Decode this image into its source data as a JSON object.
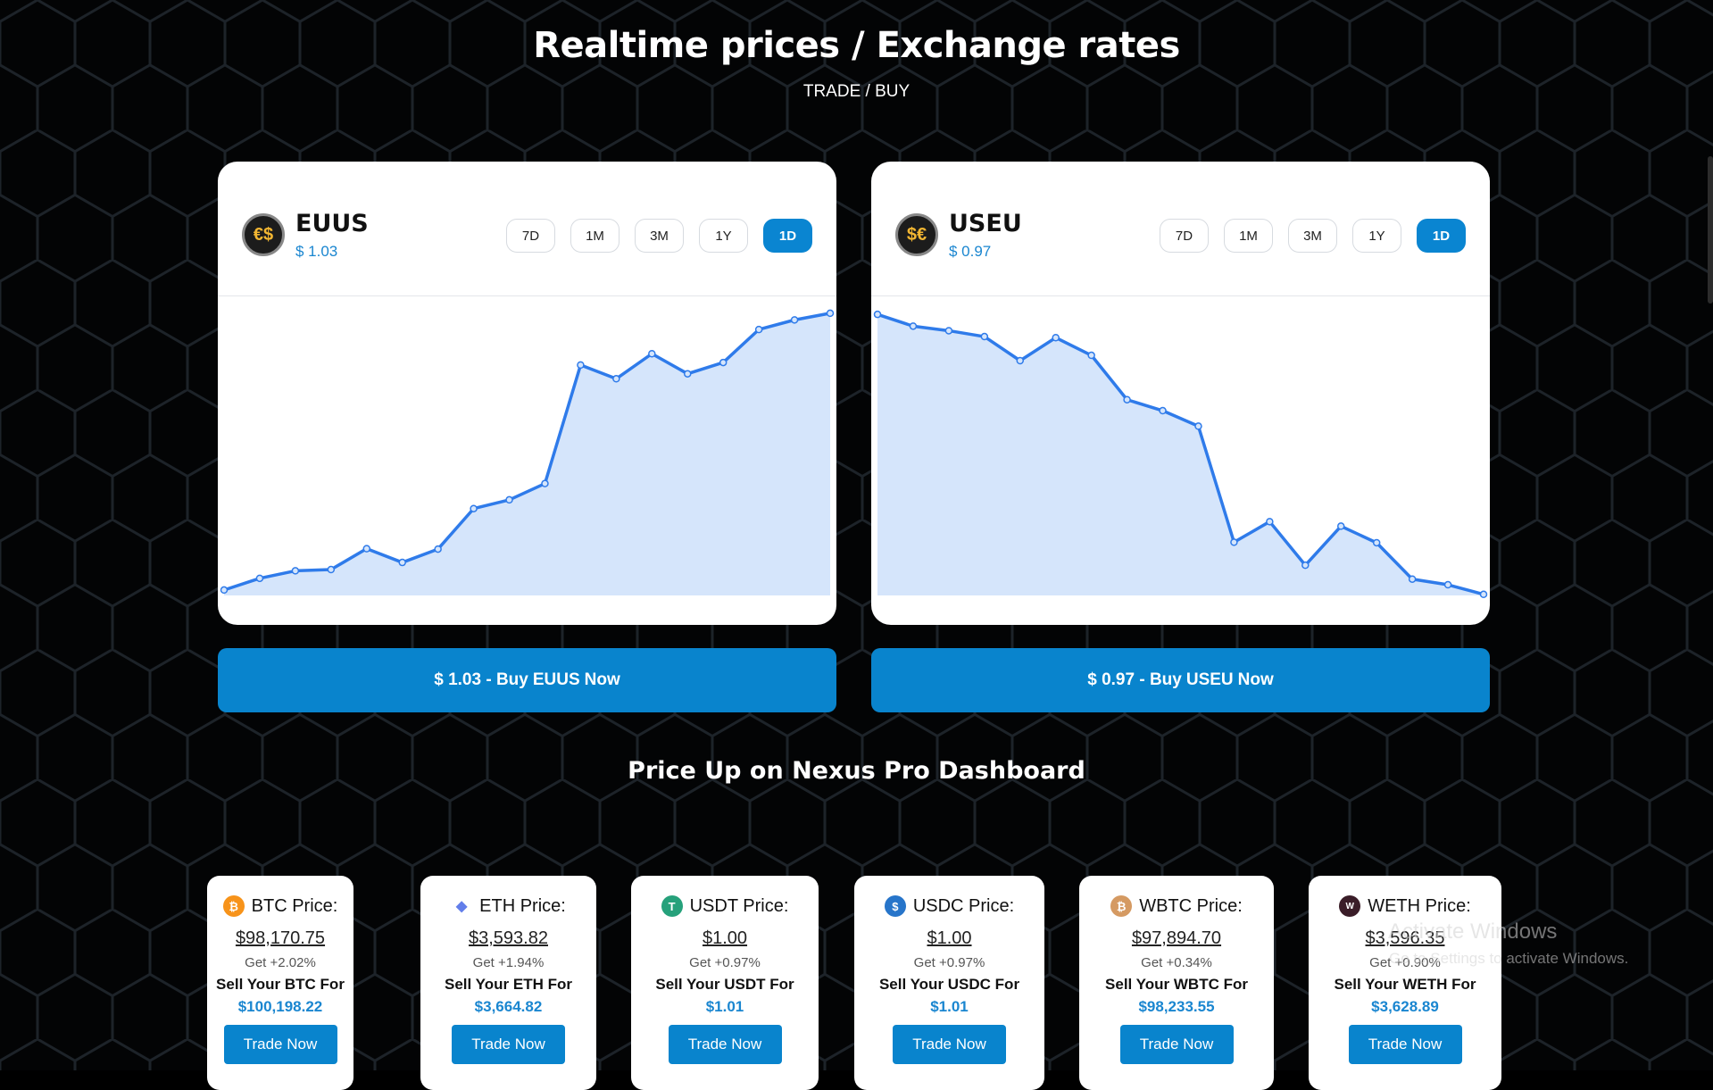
{
  "header": {
    "title": "Realtime prices / Exchange rates",
    "subtitle": "TRADE / BUY"
  },
  "chart_cards": [
    {
      "symbol": "EUUS",
      "price": "$ 1.03",
      "logo_glyphs": "€$",
      "ranges": [
        "7D",
        "1M",
        "3M",
        "1Y",
        "1D"
      ],
      "active_range": "1D",
      "buy_button": {
        "prefix": "$ 1.03 - Buy",
        "symbol": "EUUS",
        "suffix": "Now"
      }
    },
    {
      "symbol": "USEU",
      "price": "$ 0.97",
      "logo_glyphs": "$€",
      "ranges": [
        "7D",
        "1M",
        "3M",
        "1Y",
        "1D"
      ],
      "active_range": "1D",
      "buy_button": {
        "prefix": "$ 0.97 - Buy",
        "symbol": "USEU",
        "suffix": "Now"
      }
    }
  ],
  "chart_data": [
    {
      "type": "area",
      "x": [
        1,
        2,
        3,
        4,
        5,
        6,
        7,
        8,
        9,
        10,
        11,
        12,
        13,
        14,
        15,
        16,
        17,
        18
      ],
      "values": [
        0.98,
        1.26,
        1.44,
        1.47,
        1.97,
        1.64,
        1.96,
        2.93,
        3.14,
        3.53,
        6.37,
        6.04,
        6.64,
        6.16,
        6.43,
        7.22,
        7.45,
        7.61
      ],
      "ylim": [
        0.85,
        7.8
      ],
      "grid": false,
      "line_color": "#2f7bea",
      "fill_color": "#d5e5fb"
    },
    {
      "type": "area",
      "x": [
        1,
        2,
        3,
        4,
        5,
        6,
        7,
        8,
        9,
        10,
        11,
        12,
        13,
        14,
        15,
        16,
        17,
        18
      ],
      "values": [
        9.66,
        9.22,
        9.05,
        8.83,
        7.93,
        8.79,
        8.13,
        6.47,
        6.06,
        5.48,
        1.14,
        1.91,
        0.28,
        1.74,
        1.12,
        -0.24,
        -0.45,
        -0.81
      ],
      "ylim": [
        -0.85,
        10.0
      ],
      "grid": false,
      "line_color": "#2f7bea",
      "fill_color": "#d5e5fb"
    }
  ],
  "section_title": "Price Up on Nexus Pro Dashboard",
  "price_cards": [
    {
      "coin": "BTC",
      "label": "BTC Price:",
      "price": "$98,170.75",
      "get": "Get +2.02%",
      "sell": "Sell Your BTC For",
      "sell_price": "$100,198.22",
      "trade": "Trade Now",
      "icon": "bitcoin-icon",
      "icon_glyph": "₿",
      "icon_color": "#f7931a"
    },
    {
      "coin": "ETH",
      "label": "ETH Price:",
      "price": "$3,593.82",
      "get": "Get +1.94%",
      "sell": "Sell Your ETH For",
      "sell_price": "$3,664.82",
      "trade": "Trade Now",
      "icon": "ethereum-icon",
      "icon_glyph": "◆",
      "icon_color": "#627eea"
    },
    {
      "coin": "USDT",
      "label": "USDT Price:",
      "price": "$1.00",
      "get": "Get +0.97%",
      "sell": "Sell Your USDT For",
      "sell_price": "$1.01",
      "trade": "Trade Now",
      "icon": "tether-icon",
      "icon_glyph": "T",
      "icon_color": "#26a17b"
    },
    {
      "coin": "USDC",
      "label": "USDC Price:",
      "price": "$1.00",
      "get": "Get +0.97%",
      "sell": "Sell Your USDC For",
      "sell_price": "$1.01",
      "trade": "Trade Now",
      "icon": "usdc-icon",
      "icon_glyph": "$",
      "icon_color": "#2775ca"
    },
    {
      "coin": "WBTC",
      "label": "WBTC Price:",
      "price": "$97,894.70",
      "get": "Get +0.34%",
      "sell": "Sell Your WBTC For",
      "sell_price": "$98,233.55",
      "trade": "Trade Now",
      "icon": "wrapped-bitcoin-icon",
      "icon_glyph": "₿",
      "icon_color": "#d59a62"
    },
    {
      "coin": "WETH",
      "label": "WETH Price:",
      "price": "$3,596.35",
      "get": "Get +0.90%",
      "sell": "Sell Your WETH For",
      "sell_price": "$3,628.89",
      "trade": "Trade Now",
      "icon": "wrapped-ether-icon",
      "icon_glyph": "W",
      "icon_color": "#3a1d28"
    }
  ],
  "watermark": {
    "line1": "Activate Windows",
    "line2": "Go to Settings to activate Windows."
  }
}
